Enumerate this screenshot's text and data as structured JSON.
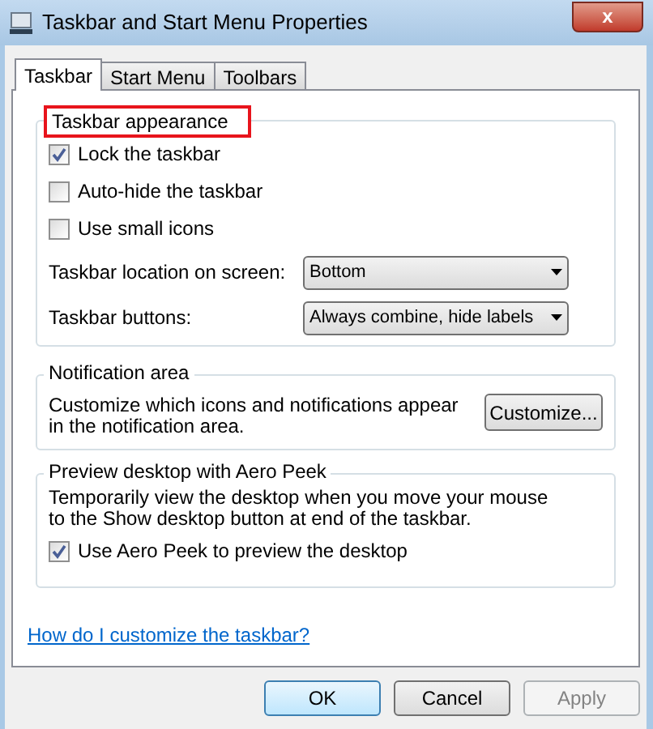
{
  "window": {
    "title": "Taskbar and Start Menu Properties",
    "close_label": "x"
  },
  "tabs": [
    {
      "label": "Taskbar",
      "selected": true
    },
    {
      "label": "Start Menu",
      "selected": false
    },
    {
      "label": "Toolbars",
      "selected": false
    }
  ],
  "appearance": {
    "title": "Taskbar appearance",
    "highlighted": true,
    "checkboxes": [
      {
        "label": "Lock the taskbar",
        "checked": true
      },
      {
        "label": "Auto-hide the taskbar",
        "checked": false
      },
      {
        "label": "Use small icons",
        "checked": false
      }
    ],
    "dropdowns": [
      {
        "label": "Taskbar location on screen:",
        "value": "Bottom"
      },
      {
        "label": "Taskbar buttons:",
        "value": "Always combine, hide labels"
      }
    ]
  },
  "notification": {
    "title": "Notification area",
    "text": "Customize which icons and notifications appear in the notification area.",
    "button": "Customize..."
  },
  "aero_peek": {
    "title": "Preview desktop with Aero Peek",
    "text": "Temporarily view the desktop when you move your mouse to the Show desktop button at end of the taskbar.",
    "checkbox": {
      "label": "Use Aero Peek to preview the desktop",
      "checked": true
    }
  },
  "help_link": "How do I customize the taskbar?",
  "buttons": [
    {
      "label": "OK",
      "default": true,
      "disabled": false
    },
    {
      "label": "Cancel",
      "default": false,
      "disabled": false
    },
    {
      "label": "Apply",
      "default": false,
      "disabled": true
    }
  ]
}
